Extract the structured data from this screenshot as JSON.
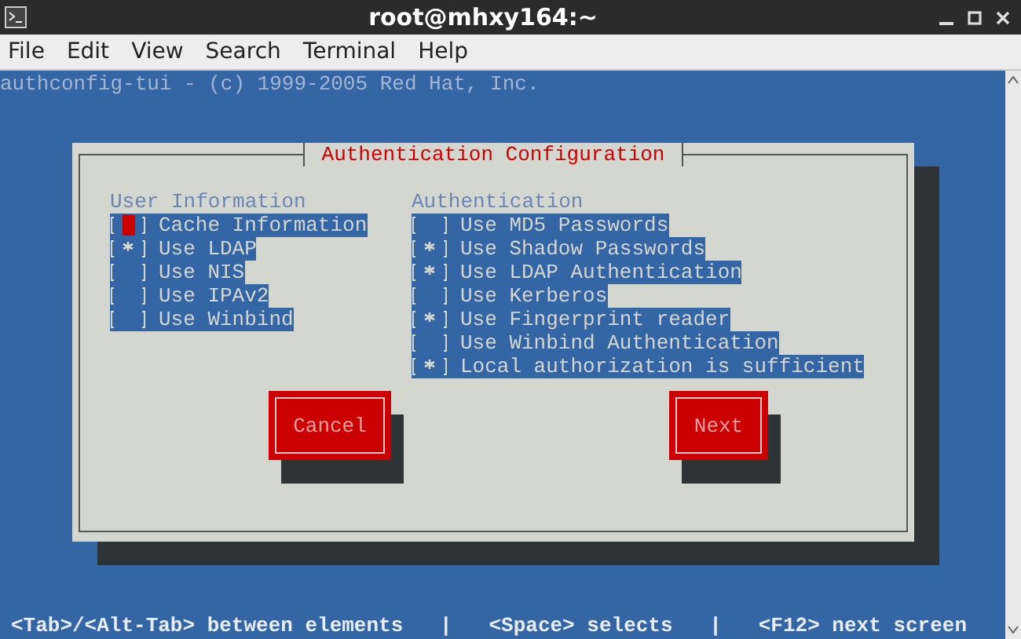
{
  "window": {
    "title": "root@mhxy164:~"
  },
  "menu": [
    "File",
    "Edit",
    "View",
    "Search",
    "Terminal",
    "Help"
  ],
  "terminal": {
    "header_line": "authconfig-tui - (c) 1999-2005 Red Hat, Inc.",
    "dialog": {
      "title": "Authentication Configuration",
      "columns": [
        {
          "heading": "User Information",
          "options": [
            {
              "label": "Cache Information",
              "checked": false,
              "focused": true
            },
            {
              "label": "Use LDAP",
              "checked": true,
              "focused": false
            },
            {
              "label": "Use NIS",
              "checked": false,
              "focused": false
            },
            {
              "label": "Use IPAv2",
              "checked": false,
              "focused": false
            },
            {
              "label": "Use Winbind",
              "checked": false,
              "focused": false
            }
          ]
        },
        {
          "heading": "Authentication",
          "options": [
            {
              "label": "Use MD5 Passwords",
              "checked": false,
              "focused": false
            },
            {
              "label": "Use Shadow Passwords",
              "checked": true,
              "focused": false
            },
            {
              "label": "Use LDAP Authentication",
              "checked": true,
              "focused": false
            },
            {
              "label": "Use Kerberos",
              "checked": false,
              "focused": false
            },
            {
              "label": "Use Fingerprint reader",
              "checked": true,
              "focused": false
            },
            {
              "label": "Use Winbind Authentication",
              "checked": false,
              "focused": false
            },
            {
              "label": "Local authorization is sufficient",
              "checked": true,
              "focused": false
            }
          ]
        }
      ],
      "buttons": [
        "Cancel",
        "Next"
      ]
    },
    "help_line": "<Tab>/<Alt-Tab> between elements   |   <Space> selects   |   <F12> next screen"
  }
}
